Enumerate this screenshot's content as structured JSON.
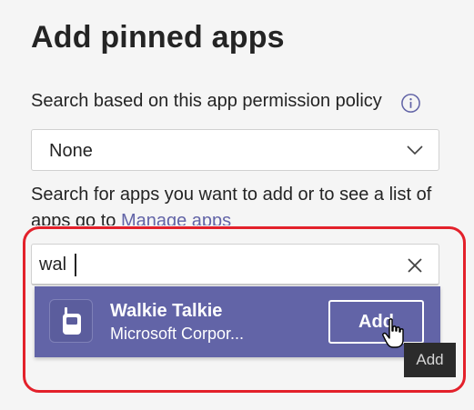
{
  "page": {
    "title": "Add pinned apps"
  },
  "policy": {
    "label": "Search based on this app permission policy",
    "selected_value": "None"
  },
  "search": {
    "hint_text": "Search for apps you want to add or to see a list of apps go to ",
    "hint_link": "Manage apps",
    "value": "wal"
  },
  "result": {
    "app_name": "Walkie Talkie",
    "publisher": "Microsoft Corpor...",
    "add_label": "Add"
  },
  "tooltip": {
    "text": "Add"
  },
  "icons": {
    "info": "info-icon",
    "select_chevron": "chevron-down-icon",
    "clear": "close-icon",
    "app": "walkie-talkie-icon",
    "cursor": "hand-pointer-icon"
  },
  "colors": {
    "accent": "#6264a7",
    "annotation": "#e3212b",
    "tooltip_bg": "#2b2b2b"
  }
}
